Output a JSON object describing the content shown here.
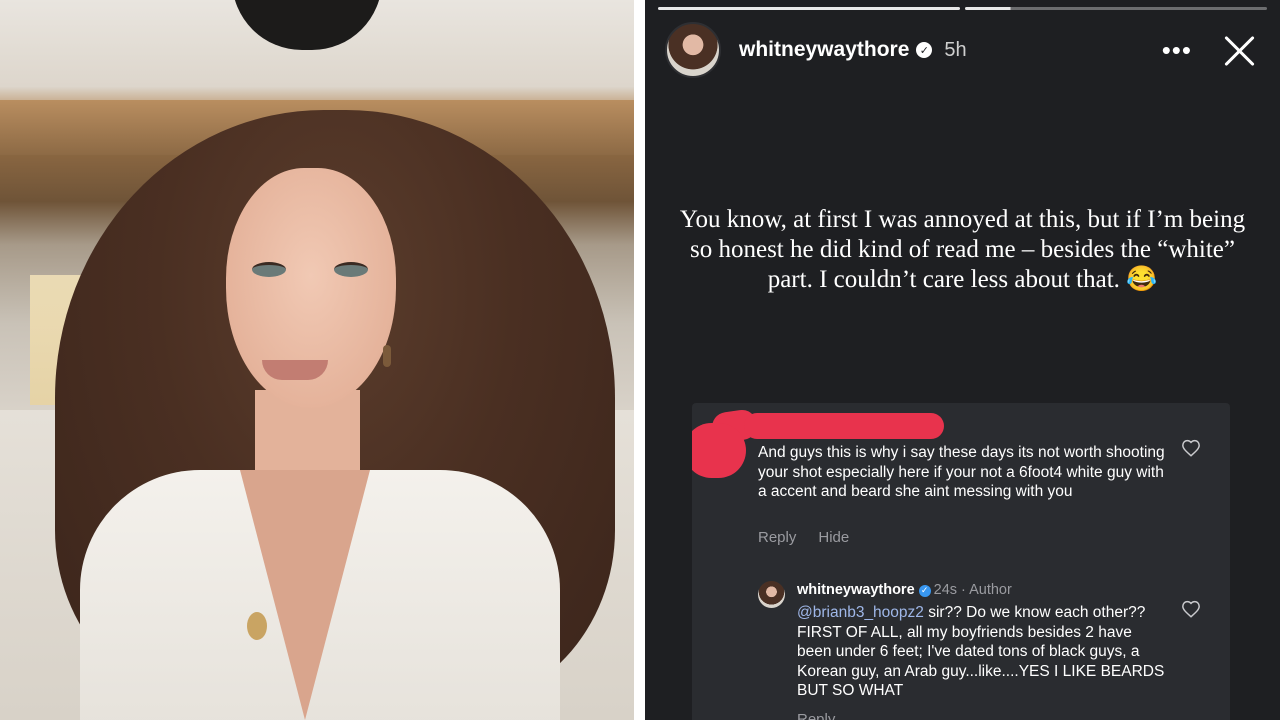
{
  "story": {
    "username": "whitneywaythore",
    "verified_glyph": "✓",
    "time_ago": "5h",
    "more_icon": "more-horizontal-icon",
    "more_glyph": "•••",
    "close_icon": "close-icon",
    "progress": [
      1,
      0.15
    ],
    "caption": "You know, at first I was annoyed at this, but if I’m being so honest he did kind of read me – besides the “white” part. I couldn’t care less about that. 😂"
  },
  "comment": {
    "text": "And guys this is why i say these days its not worth shooting your shot especially here if your not a 6foot4 white guy with a accent and beard she aint messing with you",
    "reply_label": "Reply",
    "hide_label": "Hide",
    "redaction_color": "#e8334d"
  },
  "reply": {
    "username": "whitneywaythore",
    "badge_glyph": "✓",
    "meta": "24s · Author",
    "mention": "@brianb3_hoopz2",
    "text": " sir?? Do we know each other?? FIRST OF ALL, all my boyfriends besides 2 have been under 6 feet; I've dated tons of black guys, a Korean guy, an Arab guy...like....YES I LIKE BEARDS BUT SO WHAT",
    "reply_label": "Reply"
  },
  "colors": {
    "story_bg": "#1e1f22",
    "comment_bg": "#2a2c30",
    "verified_blue": "#3897f0",
    "mention": "#9fb7e8"
  }
}
